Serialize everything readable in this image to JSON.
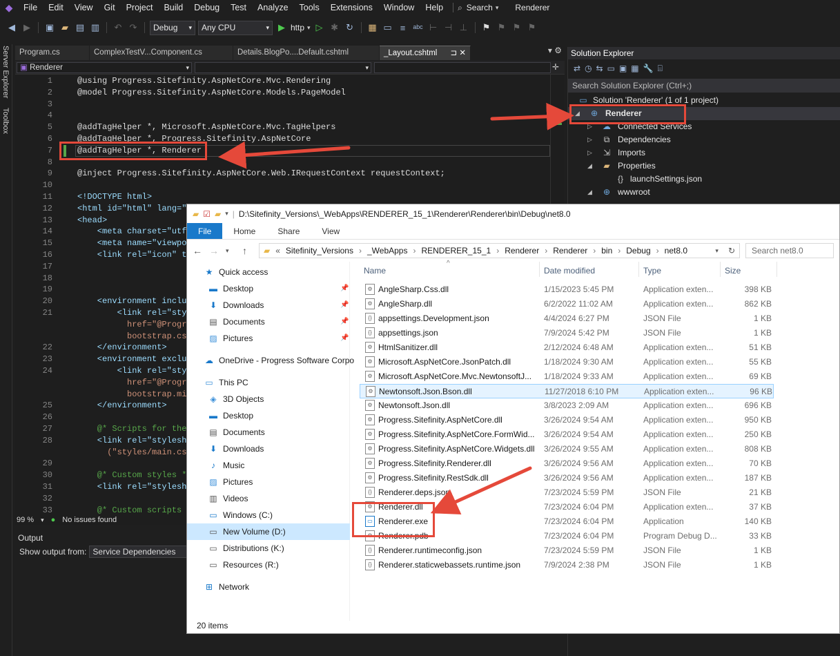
{
  "menu": {
    "items": [
      "File",
      "Edit",
      "View",
      "Git",
      "Project",
      "Build",
      "Debug",
      "Test",
      "Analyze",
      "Tools",
      "Extensions",
      "Window",
      "Help"
    ],
    "search": "Search",
    "project": "Renderer"
  },
  "toolbar": {
    "config": "Debug",
    "platform": "Any CPU",
    "run": "http"
  },
  "left_strip": {
    "server_explorer": "Server Explorer",
    "toolbox": "Toolbox"
  },
  "tabs": [
    "Program.cs",
    "ComplexTestV...Component.cs",
    "Details.BlogPo....Default.cshtml",
    "_Layout.cshtml"
  ],
  "nav_combo": "Renderer",
  "editor": {
    "lines": [
      {
        "n": "1",
        "code": "@using Progress.Sitefinity.AspNetCore.Mvc.Rendering"
      },
      {
        "n": "2",
        "code": "@model Progress.Sitefinity.AspNetCore.Models.PageModel"
      },
      {
        "n": "3",
        "code": ""
      },
      {
        "n": "4",
        "code": ""
      },
      {
        "n": "5",
        "code": "@addTagHelper *, Microsoft.AspNetCore.Mvc.TagHelpers"
      },
      {
        "n": "6",
        "code": "@addTagHelper *, Progress.Sitefinity.AspNetCore"
      },
      {
        "n": "7",
        "code": "@addTagHelper *, Renderer"
      },
      {
        "n": "8",
        "code": ""
      },
      {
        "n": "9",
        "code": "@inject Progress.Sitefinity.AspNetCore.Web.IRequestContext requestContext;"
      },
      {
        "n": "10",
        "code": ""
      },
      {
        "n": "11",
        "code": "<!DOCTYPE html>"
      },
      {
        "n": "12",
        "code": "<html id=\"html\" lang=\"e"
      },
      {
        "n": "13",
        "code": "<head>"
      },
      {
        "n": "14",
        "code": "    <meta charset=\"utf"
      },
      {
        "n": "15",
        "code": "    <meta name=\"viewpo"
      },
      {
        "n": "16",
        "code": "    <link rel=\"icon\" t"
      },
      {
        "n": "17",
        "code": ""
      },
      {
        "n": "18",
        "code": ""
      },
      {
        "n": "19",
        "code": ""
      },
      {
        "n": "20",
        "code": "    <environment inclu"
      },
      {
        "n": "21",
        "code": "        <link rel=\"sty"
      },
      {
        "n": "",
        "code": "          href=\"@Progr"
      },
      {
        "n": "",
        "code": "          bootstrap.css"
      },
      {
        "n": "22",
        "code": "    </environment>"
      },
      {
        "n": "23",
        "code": "    <environment exclu"
      },
      {
        "n": "24",
        "code": "        <link rel=\"sty"
      },
      {
        "n": "",
        "code": "          href=\"@Progr"
      },
      {
        "n": "",
        "code": "          bootstrap.min"
      },
      {
        "n": "25",
        "code": "    </environment>"
      },
      {
        "n": "26",
        "code": ""
      },
      {
        "n": "27",
        "code": "    @* Scripts for the"
      },
      {
        "n": "28",
        "code": "    <link rel=\"styleshe"
      },
      {
        "n": "",
        "code": "      (\"styles/main.css"
      },
      {
        "n": "29",
        "code": ""
      },
      {
        "n": "30",
        "code": "    @* Custom styles *@"
      },
      {
        "n": "31",
        "code": "    <link rel=\"styleshe"
      },
      {
        "n": "32",
        "code": ""
      },
      {
        "n": "33",
        "code": "    @* Custom scripts"
      }
    ],
    "zoom": "99 %",
    "issues": "No issues found"
  },
  "output": {
    "title": "Output",
    "show_from_label": "Show output from:",
    "show_from_value": "Service Dependencies"
  },
  "solution_explorer": {
    "title": "Solution Explorer",
    "search_placeholder": "Search Solution Explorer (Ctrl+;)",
    "solution": "Solution 'Renderer' (1 of 1 project)",
    "nodes": [
      "Renderer",
      "Connected Services",
      "Dependencies",
      "Imports",
      "Properties",
      "launchSettings.json",
      "wwwroot"
    ]
  },
  "explorer": {
    "title_path": "D:\\Sitefinity_Versions\\_WebApps\\RENDERER_15_1\\Renderer\\Renderer\\bin\\Debug\\net8.0",
    "ribbon_tabs": [
      "File",
      "Home",
      "Share",
      "View"
    ],
    "breadcrumb": [
      "Sitefinity_Versions",
      "_WebApps",
      "RENDERER_15_1",
      "Renderer",
      "Renderer",
      "bin",
      "Debug",
      "net8.0"
    ],
    "search_placeholder": "Search net8.0",
    "nav": [
      "Quick access",
      "Desktop",
      "Downloads",
      "Documents",
      "Pictures",
      "OneDrive - Progress Software Corpo",
      "This PC",
      "3D Objects",
      "Desktop",
      "Documents",
      "Downloads",
      "Music",
      "Pictures",
      "Videos",
      "Windows (C:)",
      "New Volume (D:)",
      "Distributions (K:)",
      "Resources (R:)",
      "Network"
    ],
    "columns": [
      "Name",
      "Date modified",
      "Type",
      "Size"
    ],
    "files": [
      {
        "name": "AngleSharp.Css.dll",
        "date": "1/15/2023 5:45 PM",
        "type": "Application exten...",
        "size": "398 KB"
      },
      {
        "name": "AngleSharp.dll",
        "date": "6/2/2022 11:02 AM",
        "type": "Application exten...",
        "size": "862 KB"
      },
      {
        "name": "appsettings.Development.json",
        "date": "4/4/2024 6:27 PM",
        "type": "JSON File",
        "size": "1 KB"
      },
      {
        "name": "appsettings.json",
        "date": "7/9/2024 5:42 PM",
        "type": "JSON File",
        "size": "1 KB"
      },
      {
        "name": "HtmlSanitizer.dll",
        "date": "2/12/2024 6:48 AM",
        "type": "Application exten...",
        "size": "51 KB"
      },
      {
        "name": "Microsoft.AspNetCore.JsonPatch.dll",
        "date": "1/18/2024 9:30 AM",
        "type": "Application exten...",
        "size": "55 KB"
      },
      {
        "name": "Microsoft.AspNetCore.Mvc.NewtonsoftJ...",
        "date": "1/18/2024 9:33 AM",
        "type": "Application exten...",
        "size": "69 KB"
      },
      {
        "name": "Newtonsoft.Json.Bson.dll",
        "date": "11/27/2018 6:10 PM",
        "type": "Application exten...",
        "size": "96 KB"
      },
      {
        "name": "Newtonsoft.Json.dll",
        "date": "3/8/2023 2:09 AM",
        "type": "Application exten...",
        "size": "696 KB"
      },
      {
        "name": "Progress.Sitefinity.AspNetCore.dll",
        "date": "3/26/2024 9:54 AM",
        "type": "Application exten...",
        "size": "950 KB"
      },
      {
        "name": "Progress.Sitefinity.AspNetCore.FormWid...",
        "date": "3/26/2024 9:54 AM",
        "type": "Application exten...",
        "size": "250 KB"
      },
      {
        "name": "Progress.Sitefinity.AspNetCore.Widgets.dll",
        "date": "3/26/2024 9:55 AM",
        "type": "Application exten...",
        "size": "808 KB"
      },
      {
        "name": "Progress.Sitefinity.Renderer.dll",
        "date": "3/26/2024 9:56 AM",
        "type": "Application exten...",
        "size": "70 KB"
      },
      {
        "name": "Progress.Sitefinity.RestSdk.dll",
        "date": "3/26/2024 9:56 AM",
        "type": "Application exten...",
        "size": "187 KB"
      },
      {
        "name": "Renderer.deps.json",
        "date": "7/23/2024 5:59 PM",
        "type": "JSON File",
        "size": "21 KB"
      },
      {
        "name": "Renderer.dll",
        "date": "7/23/2024 6:04 PM",
        "type": "Application exten...",
        "size": "37 KB"
      },
      {
        "name": "Renderer.exe",
        "date": "7/23/2024 6:04 PM",
        "type": "Application",
        "size": "140 KB"
      },
      {
        "name": "Renderer.pdb",
        "date": "7/23/2024 6:04 PM",
        "type": "Program Debug D...",
        "size": "33 KB"
      },
      {
        "name": "Renderer.runtimeconfig.json",
        "date": "7/23/2024 5:59 PM",
        "type": "JSON File",
        "size": "1 KB"
      },
      {
        "name": "Renderer.staticwebassets.runtime.json",
        "date": "7/9/2024 2:38 PM",
        "type": "JSON File",
        "size": "1 KB"
      }
    ],
    "status": "20 items"
  },
  "colors": {
    "annotation": "#e5493a",
    "vs_bg": "#1f1f1f",
    "explorer_accent": "#1979ca"
  }
}
